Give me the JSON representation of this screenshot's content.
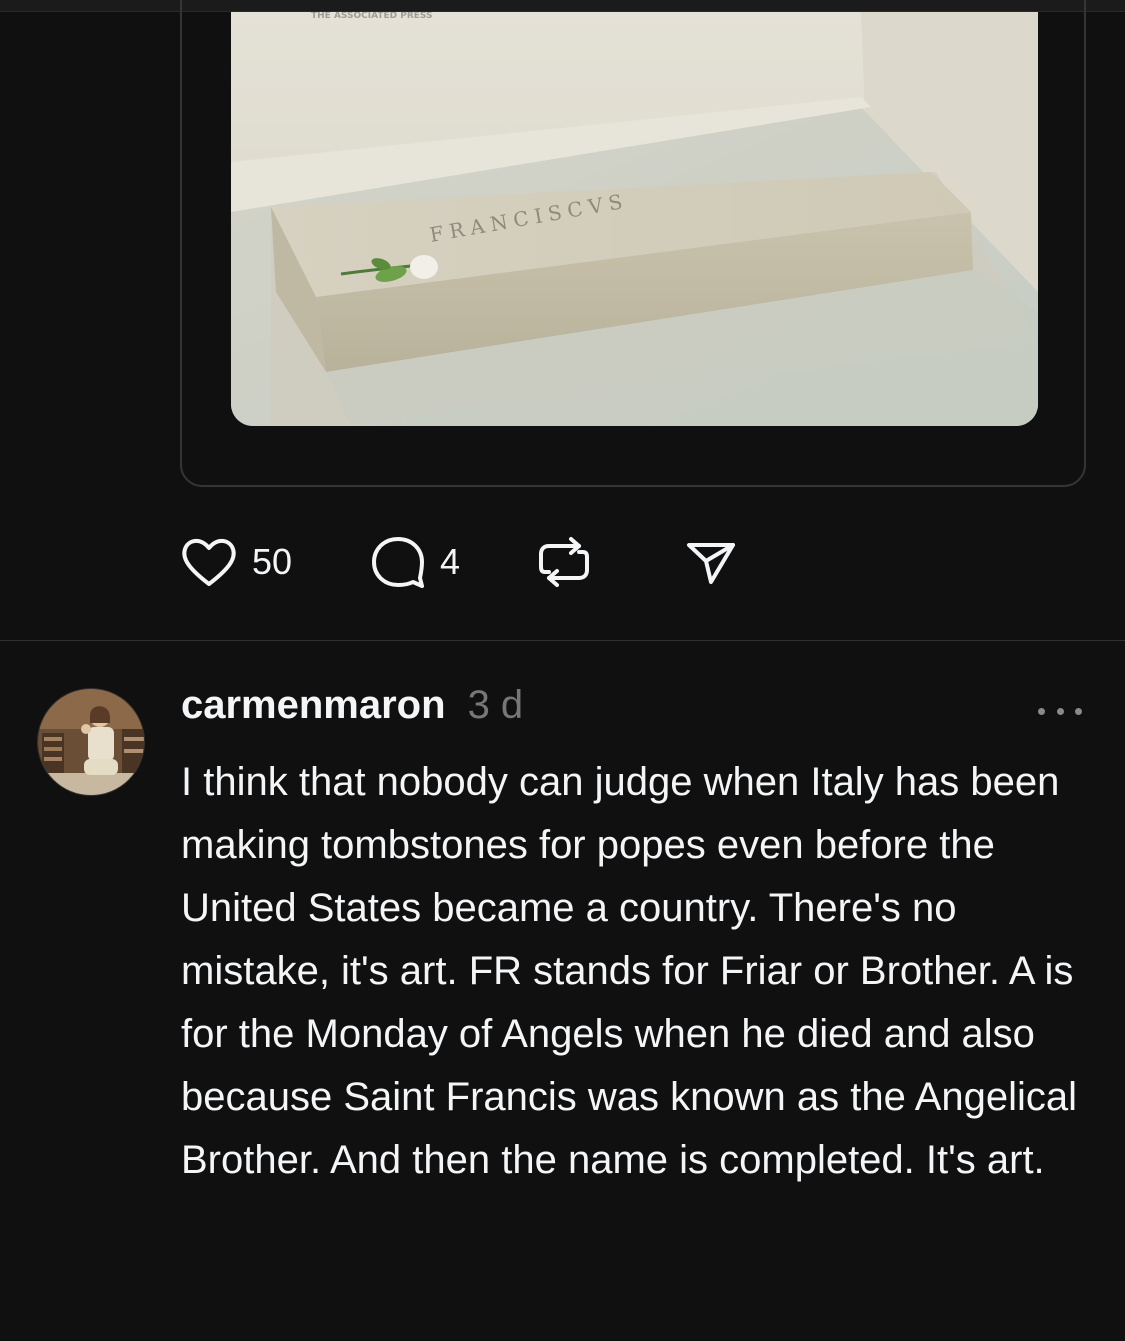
{
  "photo": {
    "watermark": "THE ASSOCIATED PRESS",
    "inscription": "FRANCISCVS"
  },
  "actions": {
    "likes": "50",
    "comments": "4"
  },
  "reply": {
    "username": "carmenmaron",
    "time": "3 d",
    "text": "I think that nobody can judge when Italy has been making tombstones for popes even before the United States became a country. There's no mistake, it's art. FR stands for Friar or Brother. A is for the Monday of Angels when he died and also because Saint Francis was known as the Angelical Brother. And then the name is completed. It's art."
  },
  "icons": [
    "heart-icon",
    "comment-icon",
    "repost-icon",
    "share-icon",
    "more-icon"
  ]
}
